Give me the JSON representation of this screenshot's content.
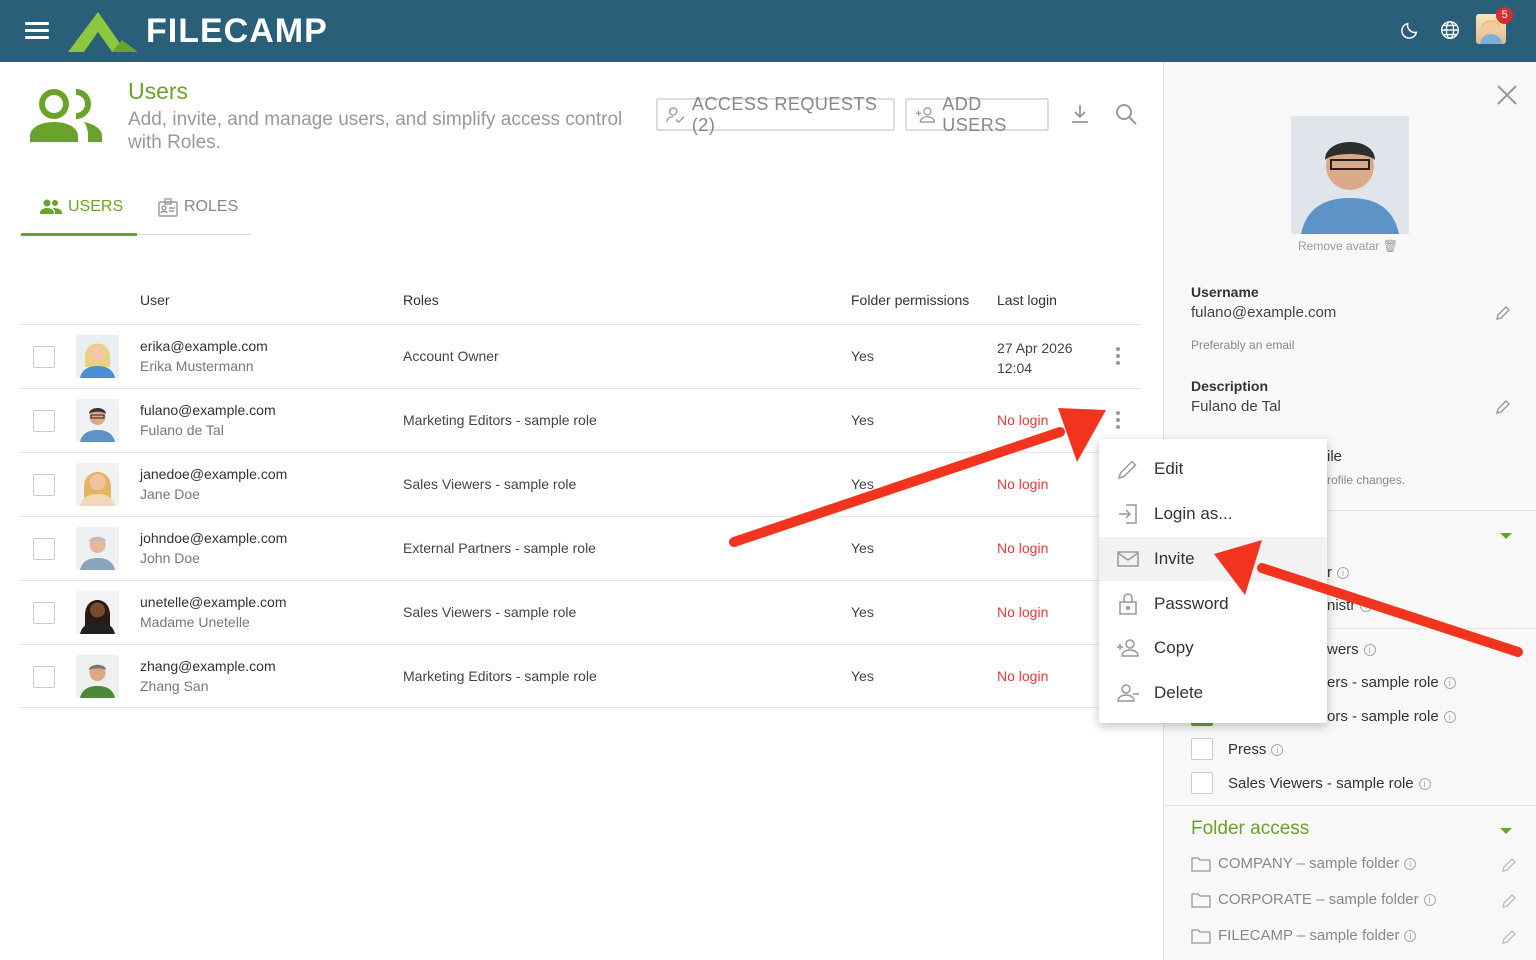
{
  "app": {
    "brand": "FILECAMP",
    "notifications": "5"
  },
  "header": {
    "title": "Users",
    "subtitle": "Add, invite, and manage users, and simplify access control with Roles.",
    "access_requests": "ACCESS REQUESTS (2)",
    "add_users": "ADD USERS"
  },
  "tabs": {
    "users": "USERS",
    "roles": "ROLES"
  },
  "table": {
    "columns": [
      "User",
      "Roles",
      "Folder permissions",
      "Last login"
    ],
    "rows": [
      {
        "email": "erika@example.com",
        "name": "Erika Mustermann",
        "role": "Account Owner",
        "perm": "Yes",
        "login_line1": "27 Apr 2026",
        "login_line2": "12:04"
      },
      {
        "email": "fulano@example.com",
        "name": "Fulano de Tal",
        "role": "Marketing Editors - sample role",
        "perm": "Yes",
        "login": "No login"
      },
      {
        "email": "janedoe@example.com",
        "name": "Jane Doe",
        "role": "Sales Viewers - sample role",
        "perm": "Yes",
        "login": "No login"
      },
      {
        "email": "johndoe@example.com",
        "name": "John Doe",
        "role": "External Partners - sample role",
        "perm": "Yes",
        "login": "No login"
      },
      {
        "email": "unetelle@example.com",
        "name": "Madame Unetelle",
        "role": "Sales Viewers - sample role",
        "perm": "Yes",
        "login": "No login"
      },
      {
        "email": "zhang@example.com",
        "name": "Zhang San",
        "role": "Marketing Editors - sample role",
        "perm": "Yes",
        "login": "No login"
      }
    ]
  },
  "menu": {
    "items": [
      "Edit",
      "Login as...",
      "Invite",
      "Password",
      "Copy",
      "Delete"
    ]
  },
  "panel": {
    "remove_avatar": "Remove avatar",
    "username_label": "Username",
    "username": "fulano@example.com",
    "username_hint": "Preferably an email",
    "description_label": "Description",
    "description": "Fulano de Tal",
    "partial_profile": "ile",
    "partial_profile_hint": "rofile changes.",
    "partial_r": "r",
    "partial_admin": "nistr",
    "partial_viewers": "wers",
    "partial_role1": "ers - sample role",
    "partial_role2": "ors - sample role",
    "press": "Press",
    "sales_viewers": "Sales Viewers - sample role",
    "folder_access": "Folder access",
    "folders": [
      "COMPANY – sample folder",
      "CORPORATE – sample folder",
      "FILECAMP – sample folder"
    ]
  },
  "colors": {
    "topbar": "#2a5f7a",
    "accent": "#6aa32b",
    "no_login": "#e53935",
    "arrow": "#f2341f"
  }
}
